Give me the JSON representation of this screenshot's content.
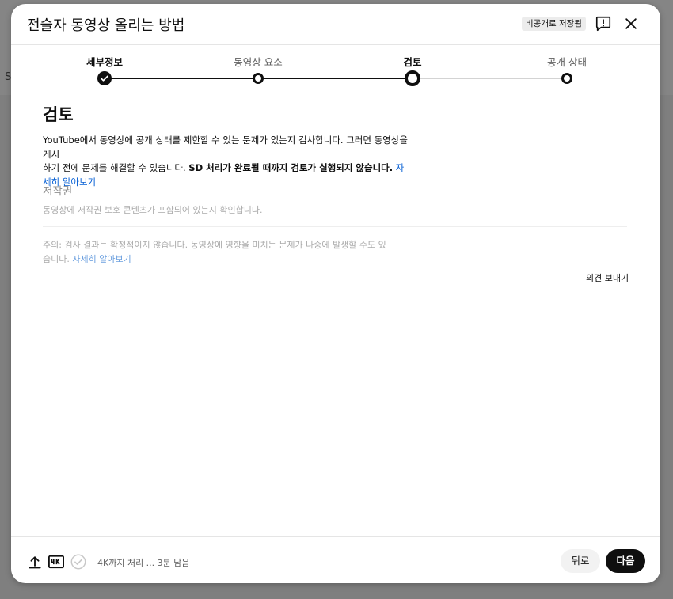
{
  "background": {
    "letter": "S"
  },
  "dialog": {
    "title": "전슬자 동영상 올리는 방법",
    "saved_badge": "비공개로 저장됨"
  },
  "steps": [
    {
      "label": "세부정보",
      "state": "done"
    },
    {
      "label": "동영상 요소",
      "state": "visited"
    },
    {
      "label": "검토",
      "state": "current"
    },
    {
      "label": "공개 상태",
      "state": "upcoming"
    }
  ],
  "review": {
    "title": "검토",
    "desc_line1": "YouTube에서 동영상에 공개 상태를 제한할 수 있는 문제가 있는지 검사합니다. 그러면 동영상을 게시",
    "desc_line2_plain": "하기 전에 문제를 해결할 수 있습니다. ",
    "desc_line2_bold": "SD 처리가 완료될 때까지 검토가 실행되지 않습니다.",
    "desc_link": "자세히 알아보기",
    "copyright_title": "저작권",
    "copyright_desc": "동영상에 저작권 보호 콘텐츠가 포함되어 있는지 확인합니다.",
    "note_text": "주의: 검사 결과는 확정적이지 않습니다. 동영상에 영향을 미치는 문제가 나중에 발생할 수도 있습니다.",
    "note_link": "자세히 알아보기",
    "feedback_link": "의견 보내기"
  },
  "footer": {
    "status": "4K까지 처리 ... 3분 남음",
    "back_label": "뒤로",
    "next_label": "다음"
  },
  "colors": {
    "link": "#065fd4",
    "primary_button": "#0f0f0f",
    "secondary_button": "#f2f2f2"
  },
  "icons": [
    "feedback-icon",
    "close-icon",
    "upload-icon",
    "hd-4k-icon",
    "check-circle-icon",
    "checkmark-icon"
  ]
}
